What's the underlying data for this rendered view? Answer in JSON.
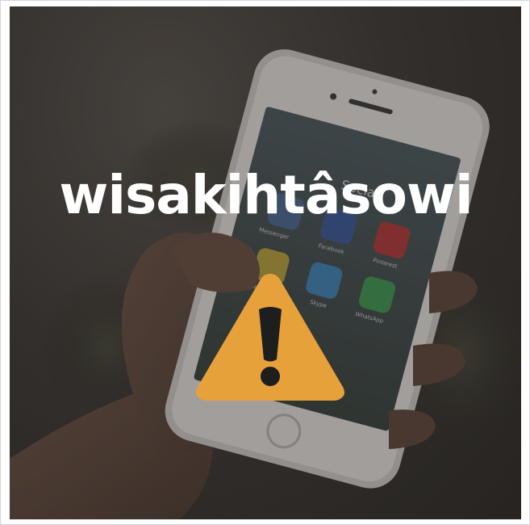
{
  "headline": "wisakihtâsowi",
  "phone_labels": {
    "folder": "Social",
    "apps": [
      "Messenger",
      "Facebook",
      "Pinterest",
      "Snapchat",
      "Skype",
      "WhatsApp"
    ]
  },
  "icons": {
    "warning": "warning-triangle-icon"
  },
  "colors": {
    "overlay": "#2b2825",
    "warning_fill": "#e7a13a",
    "warning_mark": "#1e1e1e",
    "text": "#ffffff"
  }
}
